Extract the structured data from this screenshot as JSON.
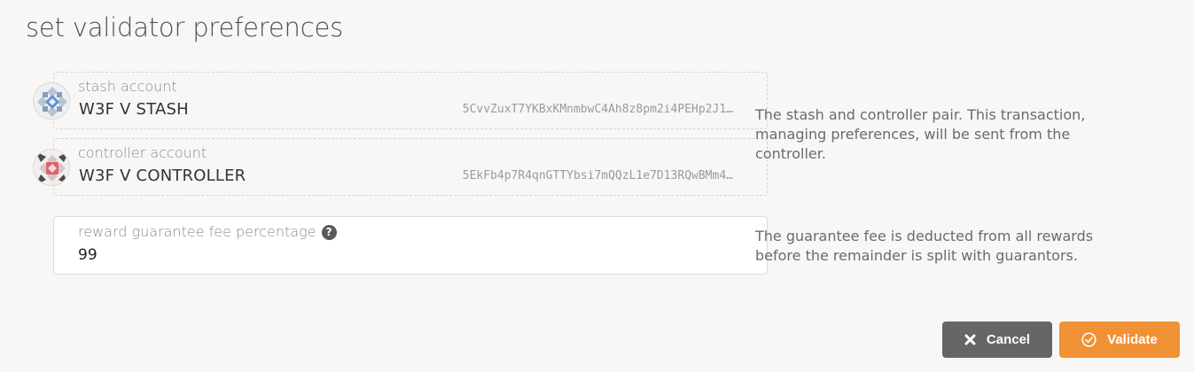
{
  "modal": {
    "title": "set validator preferences"
  },
  "stash": {
    "label": "stash account",
    "name": "W3F V STASH",
    "address": "5CvvZuxT7YKBxKMnmbwC4Ah8z8pm2i4PEHp2J1…",
    "icon": "stash-identicon"
  },
  "controller": {
    "label": "controller account",
    "name": "W3F V CONTROLLER",
    "address": "5EkFb4p7R4qnGTTYbsi7mQQzL1e7D13RQwBMm4…",
    "icon": "controller-identicon"
  },
  "accounts_help": "The stash and controller pair. This transaction, managing preferences, will be sent from the controller.",
  "fee": {
    "label": "reward guarantee fee percentage",
    "value": "99",
    "help_icon": "question-icon"
  },
  "fee_help": "The guarantee fee is deducted from all rewards before the remainder is split with guarantors.",
  "actions": {
    "cancel": "Cancel",
    "validate": "Validate",
    "cancel_icon": "close-icon",
    "validate_icon": "check-circle-icon"
  },
  "colors": {
    "validate": "#f19135",
    "cancel": "#666666",
    "background": "#f8f7f6"
  }
}
